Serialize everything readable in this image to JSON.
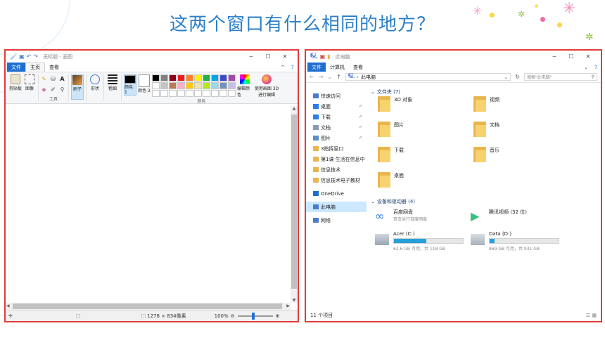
{
  "slide": {
    "title": "这两个窗口有什么相同的地方？"
  },
  "paint": {
    "title": "无标题 - 画图",
    "tabs": [
      "文件",
      "主页",
      "查看"
    ],
    "groups": {
      "clipboard": {
        "paste": "剪贴板",
        "image": "图像"
      },
      "tools": "工具",
      "brushes": "刷子",
      "shapes": "形状",
      "size": "粗细",
      "color1": "颜色 1",
      "color2": "颜色 2",
      "colors": "颜色",
      "edit_colors": "编辑颜色",
      "paint3d": "使用画图 3D 进行编辑"
    },
    "palette": [
      "#000000",
      "#7f7f7f",
      "#880015",
      "#ed1c24",
      "#ff7f27",
      "#fff200",
      "#22b14c",
      "#00a2e8",
      "#3f48cc",
      "#a349a4",
      "#ffffff",
      "#c3c3c3",
      "#b97a57",
      "#ffaec9",
      "#ffc90e",
      "#efe4b0",
      "#b5e61d",
      "#99d9ea",
      "#7092be",
      "#c8bfe7",
      "#ffffff",
      "#ffffff",
      "#ffffff",
      "#ffffff",
      "#ffffff",
      "#ffffff",
      "#ffffff",
      "#ffffff",
      "#ffffff",
      "#ffffff"
    ],
    "status": {
      "dimensions": "1278 × 834像素",
      "zoom": "100%"
    }
  },
  "explorer": {
    "title": "此电脑",
    "tabs": [
      "文件",
      "计算机",
      "查看"
    ],
    "address": "此电脑",
    "search_placeholder": "搜索\"此电脑\"",
    "nav": [
      {
        "label": "快速访问",
        "pinned": false
      },
      {
        "label": "桌面",
        "pinned": true
      },
      {
        "label": "下载",
        "pinned": true
      },
      {
        "label": "文档",
        "pinned": true
      },
      {
        "label": "图片",
        "pinned": true
      },
      {
        "label": "3指挥窗口",
        "pinned": false
      },
      {
        "label": "第1课 生活在信息中",
        "pinned": false
      },
      {
        "label": "信息技术",
        "pinned": false
      },
      {
        "label": "信息技术电子教材",
        "pinned": false
      },
      {
        "label": "OneDrive",
        "pinned": false
      },
      {
        "label": "此电脑",
        "pinned": false
      },
      {
        "label": "网络",
        "pinned": false
      }
    ],
    "folders_header": "文件夹 (7)",
    "folders": [
      "3D 对象",
      "视频",
      "图片",
      "文档",
      "下载",
      "音乐",
      "桌面"
    ],
    "devices_header": "设备和驱动器 (4)",
    "devices": [
      {
        "name": "百度网盘",
        "sub": "双击运行百度网盘"
      },
      {
        "name": "腾讯视频 (32 位)",
        "sub": ""
      }
    ],
    "drives": [
      {
        "name": "Acer (C:)",
        "free": "62.6 GB 可用，共 118 GB",
        "used": 0.47
      },
      {
        "name": "Data (D:)",
        "free": "869 GB 可用，共 931 GB",
        "used": 0.07
      }
    ],
    "status": "11 个项目"
  }
}
